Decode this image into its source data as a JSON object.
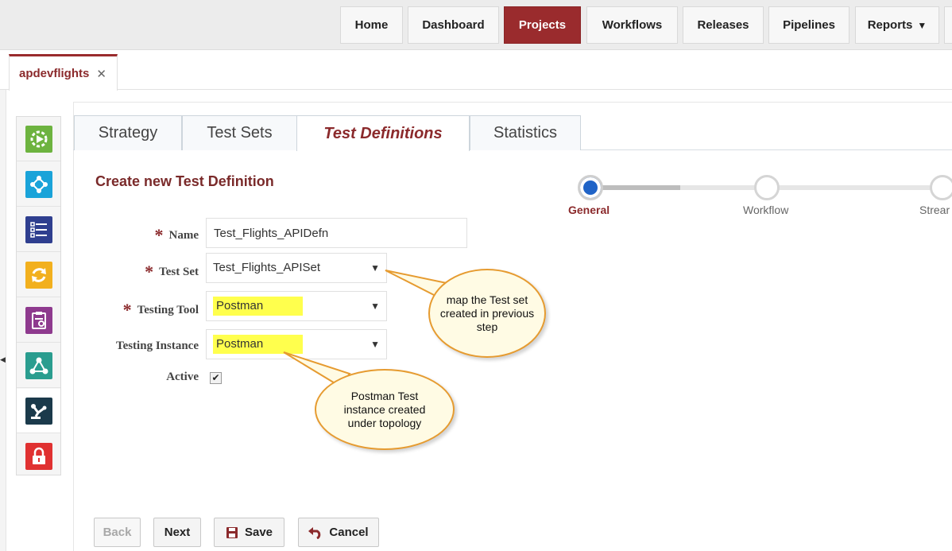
{
  "topnav": {
    "items": [
      {
        "label": "Home"
      },
      {
        "label": "Dashboard"
      },
      {
        "label": "Projects"
      },
      {
        "label": "Workflows"
      },
      {
        "label": "Releases"
      },
      {
        "label": "Pipelines"
      },
      {
        "label": "Reports"
      }
    ],
    "active": "Projects",
    "accent_color": "#9a2b2d"
  },
  "project_tab": {
    "label": "apdevflights",
    "close_icon": "close-icon"
  },
  "sidebar": {
    "items": [
      {
        "icon": "gear-play-icon",
        "color": "#6db33f"
      },
      {
        "icon": "network-icon",
        "color": "#1aa3d9"
      },
      {
        "icon": "list-icon",
        "color": "#2f3f8f"
      },
      {
        "icon": "refresh-icon",
        "color": "#f2b01e"
      },
      {
        "icon": "clipboard-icon",
        "color": "#8e3a8e"
      },
      {
        "icon": "pipeline-icon",
        "color": "#2a9d8f"
      },
      {
        "icon": "robot-arm-icon",
        "color": "#1b3a4b"
      },
      {
        "icon": "lock-icon",
        "color": "#e03131"
      }
    ],
    "active_index": 6
  },
  "tabs": [
    {
      "label": "Strategy"
    },
    {
      "label": "Test Sets"
    },
    {
      "label": "Test Definitions"
    },
    {
      "label": "Statistics"
    }
  ],
  "form": {
    "title": "Create new Test Definition",
    "name_label": "Name",
    "name_value": "Test_Flights_APIDefn",
    "testset_label": "Test Set",
    "testset_value": "Test_Flights_APISet",
    "tool_label": "Testing Tool",
    "tool_value": "Postman",
    "instance_label": "Testing Instance",
    "instance_value": "Postman",
    "active_label": "Active",
    "active_checked": true,
    "required_mark": "*"
  },
  "stepper": {
    "steps": [
      {
        "label": "General"
      },
      {
        "label": "Workflow"
      },
      {
        "label": "Strear"
      }
    ],
    "current": 0
  },
  "callouts": {
    "testset_note": "map the Test set created in previous step",
    "instance_note": "Postman Test instance created under topology"
  },
  "buttons": {
    "back": "Back",
    "next": "Next",
    "save": "Save",
    "cancel": "Cancel"
  }
}
